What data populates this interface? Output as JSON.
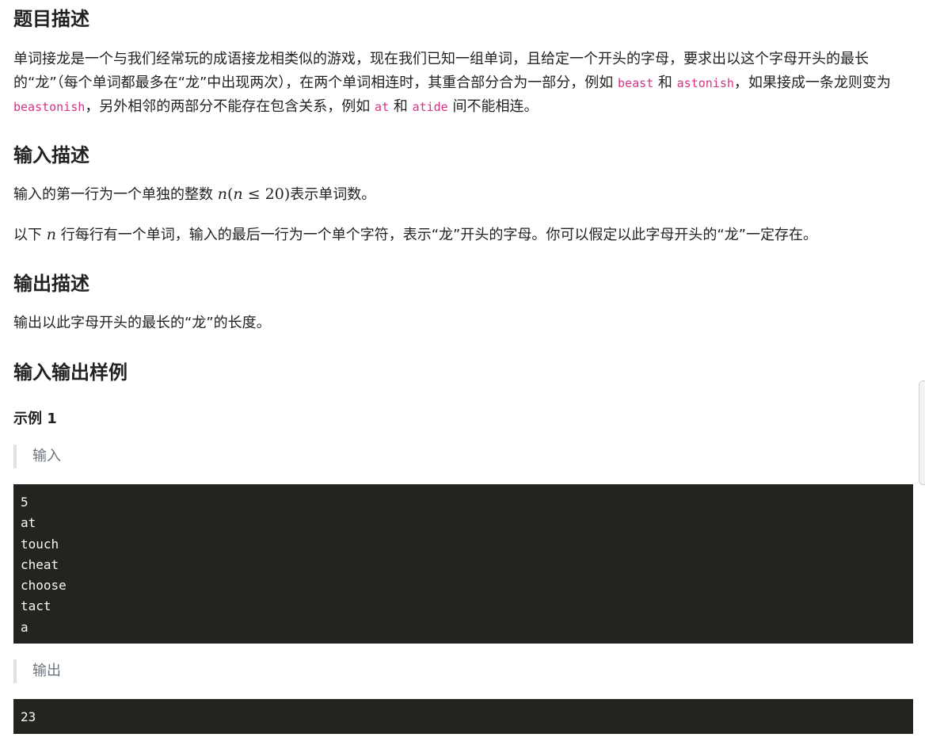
{
  "sections": {
    "description_title": "题目描述",
    "description": {
      "t1": "单词接龙是一个与我们经常玩的成语接龙相类似的游戏，现在我们已知一组单词，且给定一个开头的字母，要求出以这个字母开头的最长的“龙”（每个单词都最多在“龙”中出现两次），在两个单词相连时，其重合部分合为一部分，例如 ",
      "c1": "beast",
      "t2": " 和 ",
      "c2": "astonish",
      "t3": "，如果接成一条龙则变为 ",
      "c3": "beastonish",
      "t4": "，另外相邻的两部分不能存在包含关系，例如 ",
      "c4": "at",
      "t5": " 和 ",
      "c5": "atide",
      "t6": " 间不能相连。"
    },
    "input_title": "输入描述",
    "input": {
      "p1_before": "输入的第一行为一个单独的整数 ",
      "p1_math_var": "n",
      "p1_math_expr_open": "(",
      "p1_math_inner_var": "n",
      "p1_math_op": " ≤ ",
      "p1_math_num": "20",
      "p1_math_close": ")",
      "p1_after": "表示单词数。",
      "p2_before": "以下 ",
      "p2_math": "n",
      "p2_after": " 行每行有一个单词，输入的最后一行为一个单个字符，表示“龙”开头的字母。你可以假定以此字母开头的“龙”一定存在。"
    },
    "output_title": "输出描述",
    "output": "输出以此字母开头的最长的“龙”的长度。",
    "samples_title": "输入输出样例",
    "example_label": "示例 1",
    "input_label": "输入",
    "input_lines": [
      "5",
      "at",
      "touch",
      "cheat",
      "choose",
      "tact",
      "a"
    ],
    "output_label": "输出",
    "output_lines": [
      "23"
    ]
  }
}
